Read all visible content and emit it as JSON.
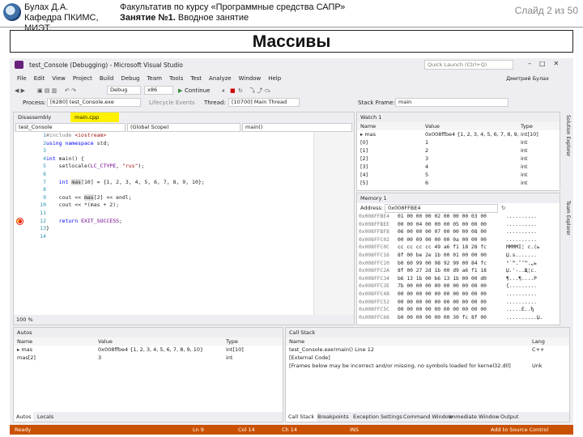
{
  "header": {
    "author": "Булах Д.А.",
    "department": "Кафедра ПКИМС, МИЭТ.",
    "course": "Факультатив по курсу «Программные средства САПР»",
    "lesson_bold": "Занятие №1.",
    "lesson_rest": " Вводное занятие",
    "slide_number": "Слайд 2 из 50"
  },
  "slide_title": "Массивы",
  "vs": {
    "window_title": "test_Console (Debugging) - Microsoft Visual Studio",
    "quick_launch": "Quick Launch (Ctrl+Q)",
    "menu": [
      "File",
      "Edit",
      "View",
      "Project",
      "Build",
      "Debug",
      "Team",
      "Tools",
      "Test",
      "Analyze",
      "Window",
      "Help"
    ],
    "user": "Дмитрий Булах",
    "toolbar": {
      "config": "Debug",
      "platform": "x86",
      "continue": "Continue",
      "process_label": "Process:",
      "process": "[6280] test_Console.exe",
      "lifecycle": "Lifecycle Events",
      "thread_label": "Thread:",
      "thread": "[10700] Main Thread",
      "stack_label": "Stack Frame:",
      "stack": "main"
    },
    "editor": {
      "tabs": [
        "Disassembly",
        "main.cpp"
      ],
      "nav": [
        "test_Console",
        "(Global Scope)",
        "main()"
      ],
      "lines": [
        {
          "n": "1",
          "html": "<span class=\"inc\">#include </span><span class=\"str\">&lt;iostream&gt;</span>"
        },
        {
          "n": "2",
          "html": "<span class=\"kw\">using namespace</span> std;"
        },
        {
          "n": "3",
          "html": ""
        },
        {
          "n": "4",
          "html": "<span class=\"kw\">int</span> main() {"
        },
        {
          "n": "5",
          "html": "    setlocale(<span class=\"mac\">LC_CTYPE</span>, <span class=\"str\">\"rus\"</span>);"
        },
        {
          "n": "6",
          "html": ""
        },
        {
          "n": "7",
          "html": "    <span class=\"kw\">int</span> <span class=\"hl\">mas</span>[10] = {1, 2, 3, 4, 5, 6, 7, 8, 9, 10};"
        },
        {
          "n": "8",
          "html": ""
        },
        {
          "n": "9",
          "html": "    cout &lt;&lt; <span class=\"hl\">mas</span>[2] &lt;&lt; endl;"
        },
        {
          "n": "10",
          "html": "    cout &lt;&lt; *(mas + 2);"
        },
        {
          "n": "11",
          "html": ""
        },
        {
          "n": "12",
          "html": "    <span class=\"kw\">return</span> <span class=\"mac\">EXIT_SUCCESS</span>;"
        },
        {
          "n": "13",
          "html": "}"
        },
        {
          "n": "14",
          "html": ""
        }
      ],
      "zoom": "100 %"
    },
    "watch": {
      "title": "Watch 1",
      "cols": [
        "Name",
        "Value",
        "Type"
      ],
      "rows": [
        {
          "name": "mas",
          "value": "0x008ffbe4 {1, 2, 3, 4, 5, 6, 7, 8, 9, 10}",
          "type": "int[10]"
        },
        {
          "name": "[0]",
          "value": "1",
          "type": "int"
        },
        {
          "name": "[1]",
          "value": "2",
          "type": "int"
        },
        {
          "name": "[2]",
          "value": "3",
          "type": "int"
        },
        {
          "name": "[3]",
          "value": "4",
          "type": "int"
        },
        {
          "name": "[4]",
          "value": "5",
          "type": "int"
        },
        {
          "name": "[5]",
          "value": "6",
          "type": "int"
        }
      ]
    },
    "memory": {
      "title": "Memory 1",
      "address_label": "Address:",
      "address": "0x008FFBE4",
      "rows": [
        {
          "a": "0x008FFBE4",
          "b": "01 00 00 00 02 00 00 00 03 00",
          "c": ".........."
        },
        {
          "a": "0x008FFBEE",
          "b": "00 00 04 00 00 00 05 00 00 00",
          "c": ".........."
        },
        {
          "a": "0x008FFBF8",
          "b": "06 00 00 00 07 00 00 00 08 00",
          "c": ".........."
        },
        {
          "a": "0x008FFC02",
          "b": "00 00 09 00 00 00 0a 00 00 00",
          "c": ".........."
        },
        {
          "a": "0x008FFC0C",
          "b": "cc cc cc cc 49 a6 f1 18 28 fc",
          "c": "ММММІ¦ c.(ь"
        },
        {
          "a": "0x008FFC16",
          "b": "8f 00 be 2e 1b 00 01 00 00 00",
          "c": "Џ.s......."
        },
        {
          "a": "0x008FFC20",
          "b": "b0 60 99 00 98 92 99 00 84 fc",
          "c": "°`™.˜’™.„ь"
        },
        {
          "a": "0x008FFC2A",
          "b": "8f 00 27 2d 1b 00 d9 a6 f1 18",
          "c": "Џ.'-..Щ¦с."
        },
        {
          "a": "0x008FFC34",
          "b": "b6 13 1b 00 b6 13 1b 00 00 d0",
          "c": "¶...¶....Р"
        },
        {
          "a": "0x008FFC3E",
          "b": "7b 00 00 00 00 00 00 00 00 00",
          "c": "{........."
        },
        {
          "a": "0x008FFC48",
          "b": "00 00 00 00 00 00 00 00 00 00",
          "c": ".........."
        },
        {
          "a": "0x008FFC52",
          "b": "00 00 00 00 00 00 00 00 00 00",
          "c": ".........."
        },
        {
          "a": "0x008FFC5C",
          "b": "00 00 00 00 00 00 00 00 00 00",
          "c": ".....E..Ђ"
        },
        {
          "a": "0x008FFC66",
          "b": "b0 00 00 00 00 00 30 fc 8f 00",
          "c": "..........Џ."
        }
      ]
    },
    "autos": {
      "title": "Autos",
      "cols": [
        "Name",
        "Value",
        "Type"
      ],
      "rows": [
        {
          "name": "mas",
          "value": "0x008ffbe4 {1, 2, 3, 4, 5, 6, 7, 8, 9, 10}",
          "type": "int[10]"
        },
        {
          "name": "mas[2]",
          "value": "3",
          "type": "int"
        }
      ],
      "tabs": [
        "Autos",
        "Locals"
      ]
    },
    "callstack": {
      "title": "Call Stack",
      "cols": [
        "Name",
        "Lang"
      ],
      "rows": [
        {
          "name": "test_Console.exe!main() Line 12",
          "lang": "C++"
        },
        {
          "name": "[External Code]",
          "lang": ""
        },
        {
          "name": "[Frames below may be incorrect and/or missing, no symbols loaded for kernel32.dll]",
          "lang": "Unk"
        }
      ],
      "tabs": [
        "Call Stack",
        "Breakpoints",
        "Exception Settings",
        "Command Window",
        "Immediate Window",
        "Output"
      ]
    },
    "status": {
      "ready": "Ready",
      "ln": "Ln 9",
      "col": "Col 14",
      "ch": "Ch 14",
      "ins": "INS",
      "source_control": "Add to Source Control"
    },
    "side_tabs": [
      "Solution Explorer",
      "Team Explorer"
    ]
  }
}
